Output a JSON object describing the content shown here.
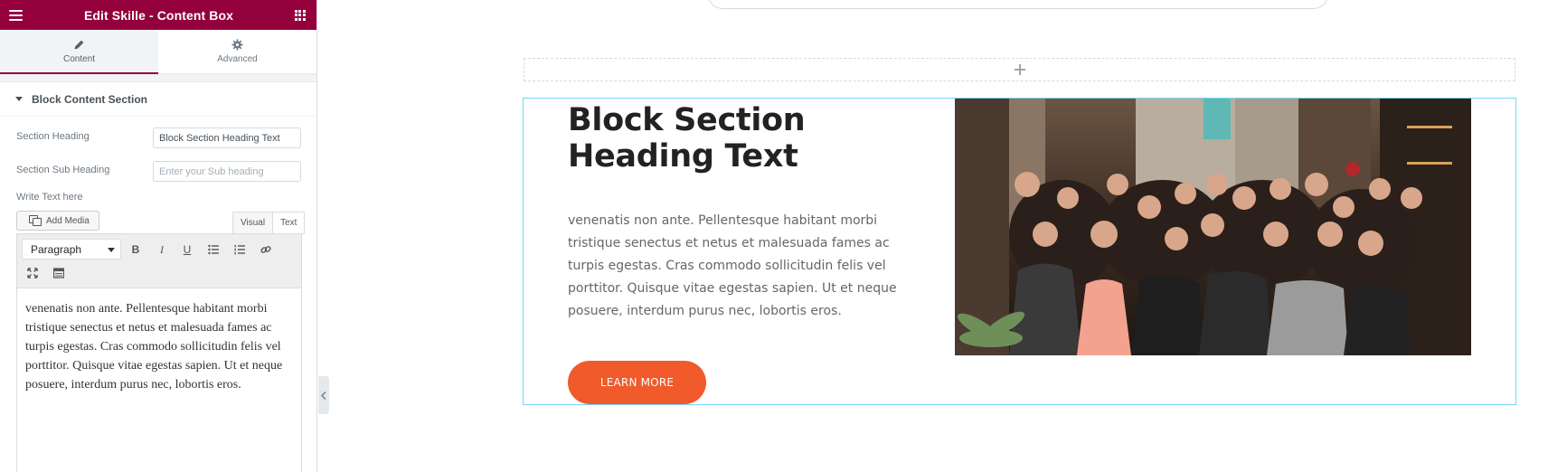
{
  "panel": {
    "title": "Edit Skille - Content Box",
    "tabs": [
      {
        "label": "Content",
        "icon": "pencil-icon",
        "active": true
      },
      {
        "label": "Advanced",
        "icon": "gear-icon",
        "active": false
      }
    ],
    "section_title": "Block Content Section",
    "fields": {
      "section_heading": {
        "label": "Section Heading",
        "value": "Block Section Heading Text"
      },
      "section_sub_heading": {
        "label": "Section Sub Heading",
        "value": "",
        "placeholder": "Enter your Sub heading"
      },
      "write_text_label": "Write Text here"
    },
    "editor": {
      "add_media_label": "Add Media",
      "visual_tab": "Visual",
      "text_tab": "Text",
      "format_select": "Paragraph",
      "toolbar_icons": [
        "bold-icon",
        "italic-icon",
        "underline-icon",
        "bullet-list-icon",
        "numbered-list-icon",
        "link-icon",
        "fullscreen-icon",
        "toolbar-toggle-icon"
      ],
      "bold": "B",
      "italic": "I",
      "underline": "U",
      "body_text": "venenatis non ante. Pellentesque habitant morbi tristique senectus et netus et malesuada fames ac turpis egestas. Cras commodo sollicitudin felis vel porttitor. Quisque vitae egestas sapien. Ut et neque posuere, interdum purus nec, lobortis eros."
    }
  },
  "canvas": {
    "block": {
      "heading": "Block Section Heading Text",
      "text": "venenatis non ante. Pellentesque habitant morbi tristique senectus et netus et malesuada fames ac turpis egestas. Cras commodo sollicitudin felis vel porttitor. Quisque vitae egestas sapien. Ut et neque posuere, interdum purus nec, lobortis eros.",
      "button_label": "LEARN MORE"
    }
  },
  "colors": {
    "panel_header": "#93003c",
    "button": "#f15a2b",
    "selection_border": "#71d7f7"
  }
}
